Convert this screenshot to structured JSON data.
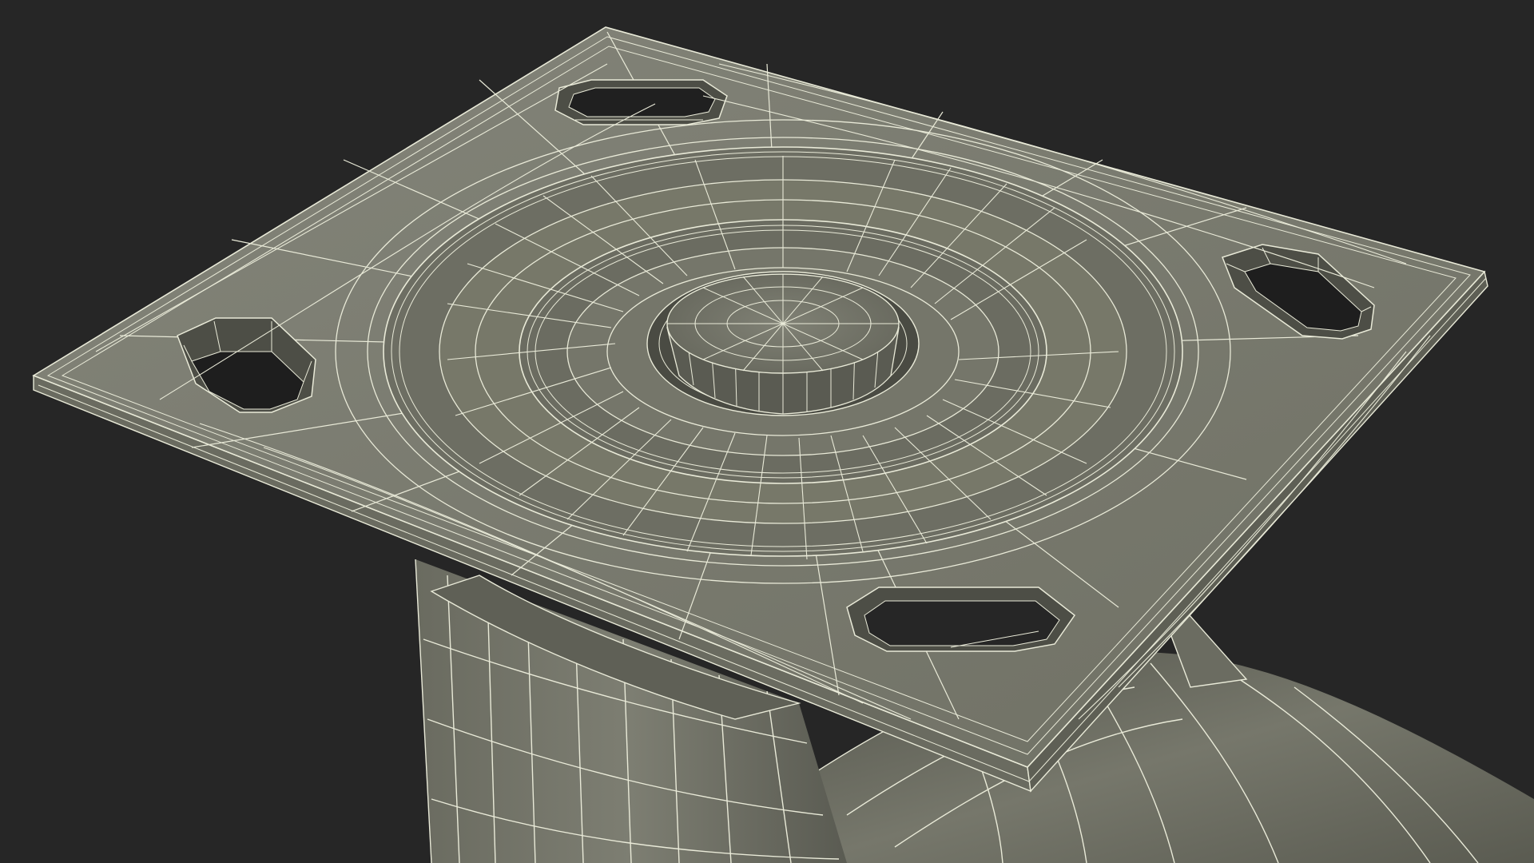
{
  "scene": {
    "subject": "caster-mount-plate-wireframe",
    "colors": {
      "background": "#262626",
      "surface": "#7a7b6e",
      "surface_dark": "#4e4f46",
      "shadow": "#3a3b34",
      "wire": "#e9ead8"
    }
  }
}
